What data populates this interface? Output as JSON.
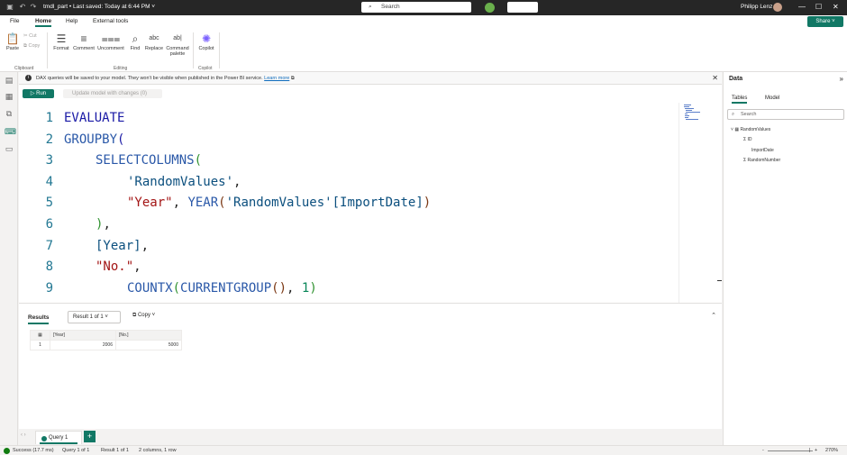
{
  "titlebar": {
    "title": "tmdl_part • Last saved: Today at 6:44 PM ˅",
    "search_placeholder": "Search",
    "user": "Philipp Lenz"
  },
  "menu": {
    "items": [
      "File",
      "Home",
      "Help",
      "External tools"
    ],
    "active": "Home",
    "share": "Share ˅"
  },
  "ribbon": {
    "paste": "Paste",
    "cut": "Cut",
    "copy": "Copy",
    "clipboard_group": "Clipboard",
    "format": "Format",
    "comment": "Comment",
    "uncomment": "Uncomment",
    "find": "Find",
    "replace": "Replace",
    "command_palette": "Command palette",
    "editing_group": "Editing",
    "copilot": "Copilot",
    "copilot_group": "Copilot"
  },
  "infobar": {
    "message": "DAX queries will be saved to your model. They won't be visible when published in the Power BI service.",
    "link": "Learn more"
  },
  "toolbar": {
    "run": "Run",
    "update": "Update model with changes (0)"
  },
  "editor": {
    "lines": [
      {
        "n": "1",
        "indent": 0,
        "tokens": [
          [
            "kw",
            "EVALUATE"
          ]
        ]
      },
      {
        "n": "2",
        "indent": 0,
        "tokens": [
          [
            "fn",
            "GROUPBY"
          ],
          [
            "p1",
            "("
          ]
        ]
      },
      {
        "n": "3",
        "indent": 1,
        "tokens": [
          [
            "fn",
            "SELECTCOLUMNS"
          ],
          [
            "p2",
            "("
          ]
        ]
      },
      {
        "n": "4",
        "indent": 2,
        "tokens": [
          [
            "tbl",
            "'RandomValues'"
          ],
          [
            "",
            ","
          ]
        ]
      },
      {
        "n": "5",
        "indent": 2,
        "tokens": [
          [
            "str",
            "\"Year\""
          ],
          [
            "",
            ", "
          ],
          [
            "fn",
            "YEAR"
          ],
          [
            "p3",
            "("
          ],
          [
            "tbl",
            "'RandomValues'"
          ],
          [
            "col",
            "[ImportDate]"
          ],
          [
            "p3",
            ")"
          ]
        ]
      },
      {
        "n": "6",
        "indent": 1,
        "tokens": [
          [
            "p2",
            ")"
          ],
          [
            "",
            ","
          ]
        ]
      },
      {
        "n": "7",
        "indent": 1,
        "tokens": [
          [
            "col",
            "[Year]"
          ],
          [
            "",
            ","
          ]
        ]
      },
      {
        "n": "8",
        "indent": 1,
        "tokens": [
          [
            "str",
            "\"No.\""
          ],
          [
            "",
            ","
          ]
        ]
      },
      {
        "n": "9",
        "indent": 2,
        "tokens": [
          [
            "fn",
            "COUNTX"
          ],
          [
            "p2",
            "("
          ],
          [
            "fn",
            "CURRENTGROUP"
          ],
          [
            "p3",
            "()"
          ],
          [
            "",
            ", "
          ],
          [
            "num",
            "1"
          ],
          [
            "p2",
            ")"
          ]
        ]
      }
    ]
  },
  "results": {
    "label": "Results",
    "selector": "Result 1 of 1",
    "copy": "Copy",
    "columns": [
      "[Year]",
      "[No.]"
    ],
    "rows": [
      [
        "1",
        "2006",
        "5000"
      ]
    ]
  },
  "tabs": {
    "query": "Query 1",
    "add": "+"
  },
  "status": {
    "success": "Success (17.7 ms)",
    "query": "Query 1 of 1",
    "result": "Result 1 of 1",
    "shape": "2 columns, 1 row",
    "zoom": "270%"
  },
  "data_pane": {
    "title": "Data",
    "tabs": [
      "Tables",
      "Model"
    ],
    "search_placeholder": "Search",
    "table": "RandomValues",
    "fields": [
      "ID",
      "ImportDate",
      "RandomNumber"
    ]
  },
  "colors": {
    "accent": "#117865",
    "titlebar": "#262626"
  }
}
